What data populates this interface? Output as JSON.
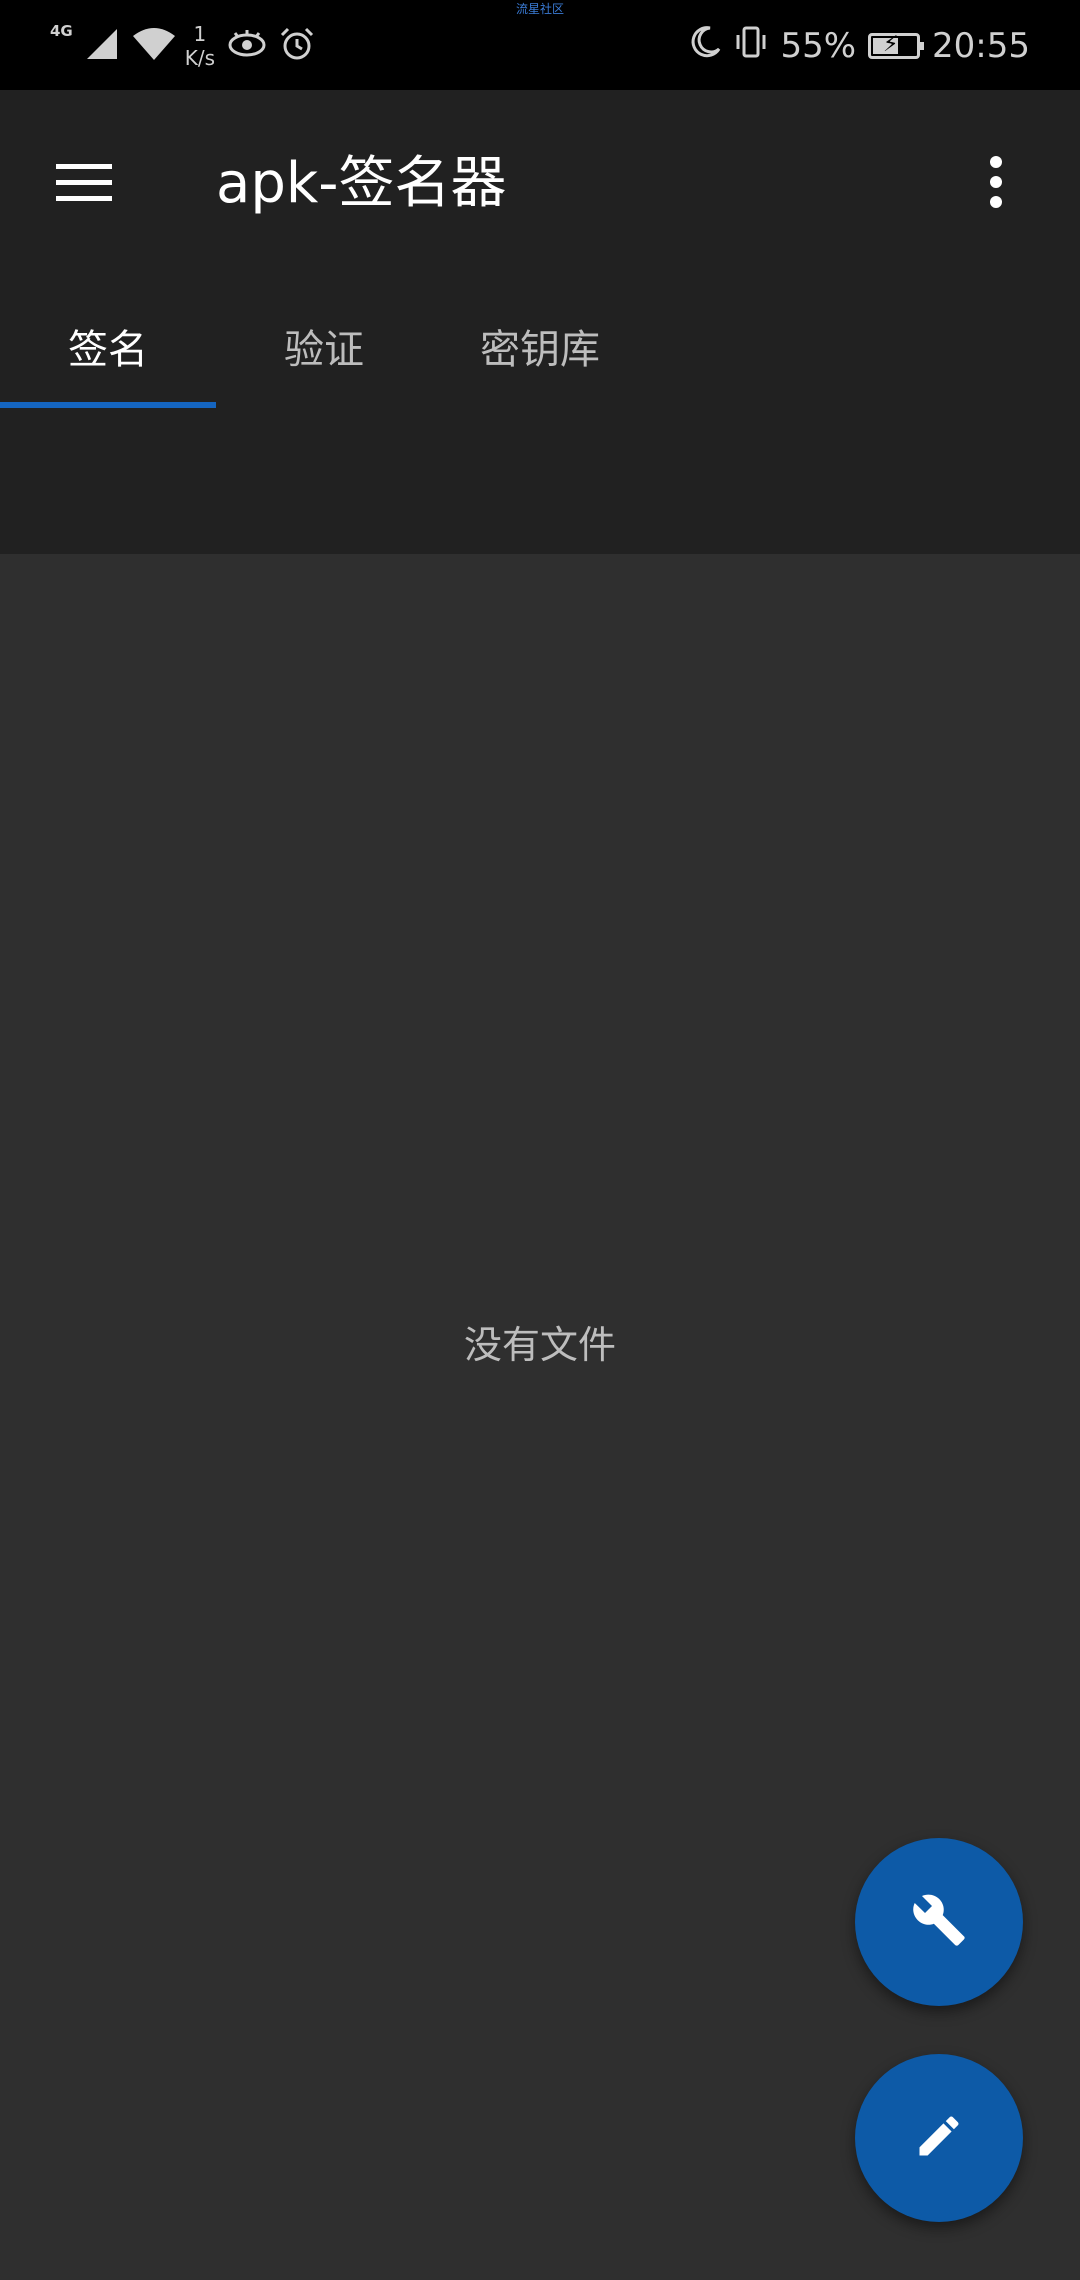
{
  "status_bar": {
    "watermark": "流星社区",
    "network_type": "4G",
    "speed_value": "1",
    "speed_unit": "K/s",
    "battery_percent": "55%",
    "battery_level": 0.55,
    "time": "20:55"
  },
  "app_bar": {
    "title": "apk-签名器",
    "menu_icon": "hamburger-menu-icon",
    "overflow_icon": "more-vert-icon"
  },
  "tabs": [
    {
      "label": "签名",
      "active": true
    },
    {
      "label": "验证",
      "active": false
    },
    {
      "label": "密钥库",
      "active": false
    }
  ],
  "content": {
    "empty_message": "没有文件"
  },
  "fabs": {
    "tool_icon": "wrench-icon",
    "edit_icon": "pencil-icon"
  },
  "colors": {
    "accent": "#1565c0",
    "fab": "#0d5aa7",
    "app_bar": "#212121",
    "background": "#2f2f2f"
  }
}
